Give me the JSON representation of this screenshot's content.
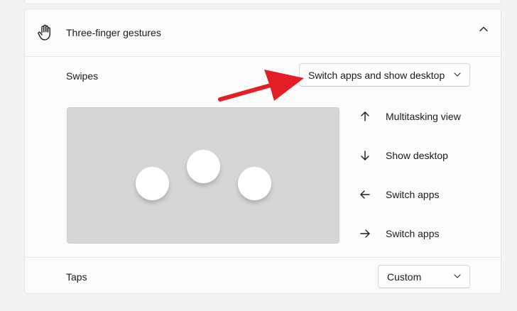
{
  "section": {
    "title": "Three-finger gestures",
    "header_icon": "hand-icon",
    "collapse_icon": "chevron-up-icon"
  },
  "swipes": {
    "label": "Swipes",
    "selected": "Switch apps and show desktop"
  },
  "directions": [
    {
      "icon": "arrow-up-icon",
      "label": "Multitasking view"
    },
    {
      "icon": "arrow-down-icon",
      "label": "Show desktop"
    },
    {
      "icon": "arrow-left-icon",
      "label": "Switch apps"
    },
    {
      "icon": "arrow-right-icon",
      "label": "Switch apps"
    }
  ],
  "taps": {
    "label": "Taps",
    "selected": "Custom"
  },
  "colors": {
    "annotation_arrow": "#e41e26",
    "preview_bg": "#d6d6d6"
  }
}
